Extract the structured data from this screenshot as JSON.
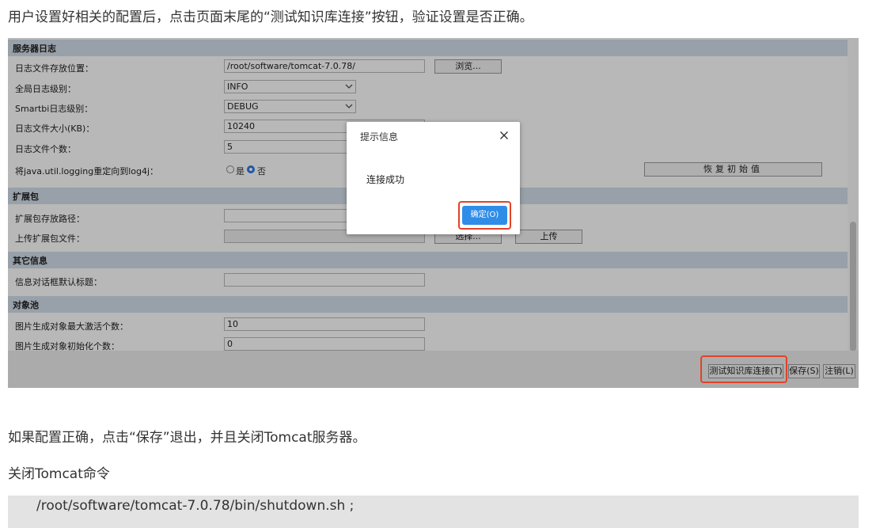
{
  "article": {
    "intro": "用户设置好相关的配置后，点击页面末尾的“测试知识库连接”按钮，验证设置是否正确。",
    "after": "如果配置正确，点击“保存”退出，并且关闭Tomcat服务器。",
    "cmd_label": "关闭Tomcat命令",
    "cmd": "/root/software/tomcat-7.0.78/bin/shutdown.sh ;"
  },
  "screenshot": {
    "sections": {
      "log": "服务器日志",
      "ext": "扩展包",
      "other": "其它信息",
      "pool": "对象池"
    },
    "fields": {
      "log_path": {
        "label": "日志文件存放位置：",
        "value": "/root/software/tomcat-7.0.78/"
      },
      "global_level": {
        "label": "全局日志级别：",
        "value": "INFO"
      },
      "smartbi_level": {
        "label": "Smartbi日志级别：",
        "value": "DEBUG"
      },
      "file_size": {
        "label": "日志文件大小(KB)：",
        "value": "10240"
      },
      "file_count": {
        "label": "日志文件个数：",
        "value": "5"
      },
      "redirect": {
        "label": "将java.util.logging重定向到log4j：",
        "yes": "是",
        "no": "否",
        "selected": "否"
      },
      "ext_path": {
        "label": "扩展包存放路径：",
        "value": ""
      },
      "ext_upload": {
        "label": "上传扩展包文件：",
        "value": ""
      },
      "dialog_title": {
        "label": "信息对话框默认标题：",
        "value": ""
      },
      "max_active": {
        "label": "图片生成对象最大激活个数：",
        "value": "10"
      },
      "init_count": {
        "label": "图片生成对象初始化个数：",
        "value": "0"
      }
    },
    "buttons": {
      "browse": "浏览...",
      "restore": "恢复初始值",
      "choose": "选择...",
      "upload": "上传",
      "test": "测试知识库连接(T)",
      "save": "保存(S)",
      "logout": "注销(L)"
    },
    "dialog": {
      "title": "提示信息",
      "message": "连接成功",
      "ok": "确定(O)"
    }
  },
  "colors": {
    "section_header": "#d3deea",
    "highlight": "#e0432a",
    "ok_button": "#2f8de8"
  }
}
